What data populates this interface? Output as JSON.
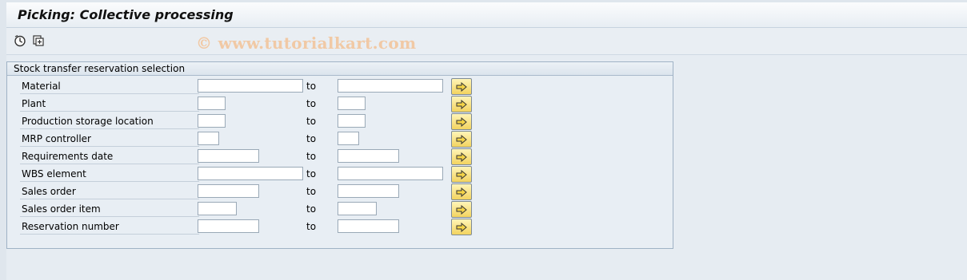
{
  "window": {
    "title": "Picking: Collective processing"
  },
  "toolbar": {
    "icons": [
      "execute-icon",
      "get-variant-icon"
    ]
  },
  "watermark": "© www.tutorialkart.com",
  "selection": {
    "group_title": "Stock transfer reservation selection",
    "to_label": "to",
    "rows": [
      {
        "label": "Material",
        "from": "",
        "to": ""
      },
      {
        "label": "Plant",
        "from": "",
        "to": ""
      },
      {
        "label": "Production storage location",
        "from": "",
        "to": ""
      },
      {
        "label": "MRP controller",
        "from": "",
        "to": ""
      },
      {
        "label": "Requirements date",
        "from": "",
        "to": ""
      },
      {
        "label": "WBS element",
        "from": "",
        "to": ""
      },
      {
        "label": "Sales order",
        "from": "",
        "to": ""
      },
      {
        "label": "Sales order item",
        "from": "",
        "to": ""
      },
      {
        "label": "Reservation number",
        "from": "",
        "to": ""
      }
    ]
  },
  "colors": {
    "accent_button": "#f3d35f",
    "panel_border": "#9fb2c5",
    "background": "#dfe6ed"
  }
}
